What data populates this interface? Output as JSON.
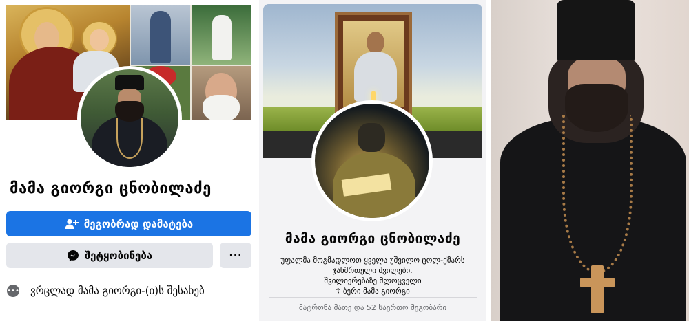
{
  "panel1": {
    "profile_name": "მამა გიორგი ცნობილაძე",
    "add_friend_label": "მეგობრად დამატება",
    "message_label": "შეტყობინება",
    "more_label": "···",
    "about_label": "ვრცლად მამა გიორგი-(ი)ს შესახებ"
  },
  "panel2": {
    "profile_name": "მამა გიორგი ცნობილაძე",
    "bio_lines": [
      "უფალმა მოგმადლოთ ყველა უშვილო ცოლ-ქმარს",
      "ჯანმრთელი შვილები.",
      "შვილიერებაზე მლოცველი",
      "☦ ბერი მამა გიორგი"
    ],
    "mutual_friends": "მატრონა მათე და 52 საერთო მეგობარი"
  },
  "colors": {
    "primary_button": "#1b74e4",
    "secondary_button": "#e4e6eb"
  }
}
